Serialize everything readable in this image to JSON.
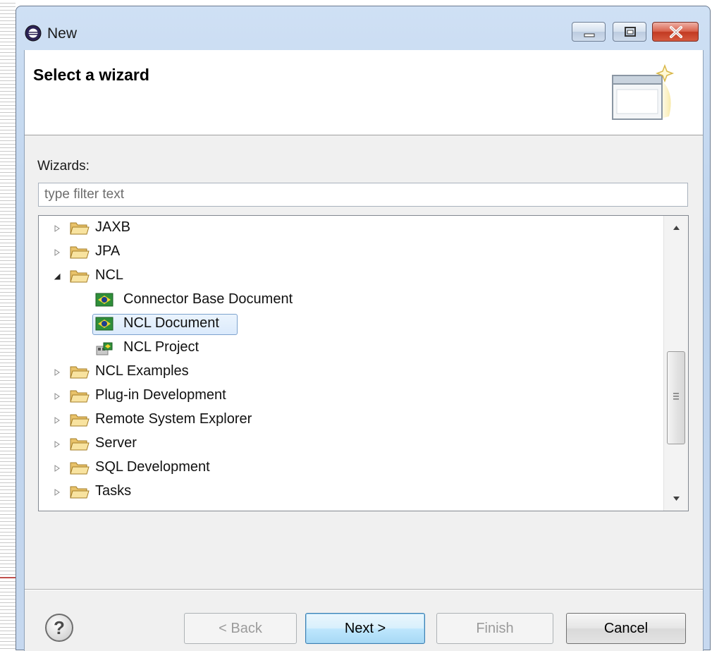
{
  "window": {
    "title": "New"
  },
  "header": {
    "title": "Select a wizard"
  },
  "wizards": {
    "label": "Wizards:",
    "filter_placeholder": "type filter text",
    "tree": [
      {
        "label": "JAXB",
        "type": "folder",
        "expanded": false,
        "level": 0
      },
      {
        "label": "JPA",
        "type": "folder",
        "expanded": false,
        "level": 0
      },
      {
        "label": "NCL",
        "type": "folder",
        "expanded": true,
        "level": 0
      },
      {
        "label": "Connector Base Document",
        "type": "doc",
        "level": 1
      },
      {
        "label": "NCL Document",
        "type": "doc",
        "level": 1,
        "selected": true
      },
      {
        "label": "NCL Project",
        "type": "project",
        "level": 1
      },
      {
        "label": "NCL Examples",
        "type": "folder",
        "expanded": false,
        "level": 0
      },
      {
        "label": "Plug-in Development",
        "type": "folder",
        "expanded": false,
        "level": 0
      },
      {
        "label": "Remote System Explorer",
        "type": "folder",
        "expanded": false,
        "level": 0
      },
      {
        "label": "Server",
        "type": "folder",
        "expanded": false,
        "level": 0
      },
      {
        "label": "SQL Development",
        "type": "folder",
        "expanded": false,
        "level": 0
      },
      {
        "label": "Tasks",
        "type": "folder",
        "expanded": false,
        "level": 0
      }
    ]
  },
  "buttons": {
    "back": "< Back",
    "next": "Next >",
    "finish": "Finish",
    "cancel": "Cancel"
  },
  "icons": {
    "app": "eclipse-icon",
    "help": "help-icon",
    "folder": "folder-icon",
    "ncl_doc": "ncl-document-icon",
    "ncl_project": "ncl-project-icon",
    "banner": "wizard-banner-icon"
  },
  "colors": {
    "selection_border": "#7da2ce",
    "folder_fill": "#f5d67b",
    "close_button": "#c23a22"
  }
}
